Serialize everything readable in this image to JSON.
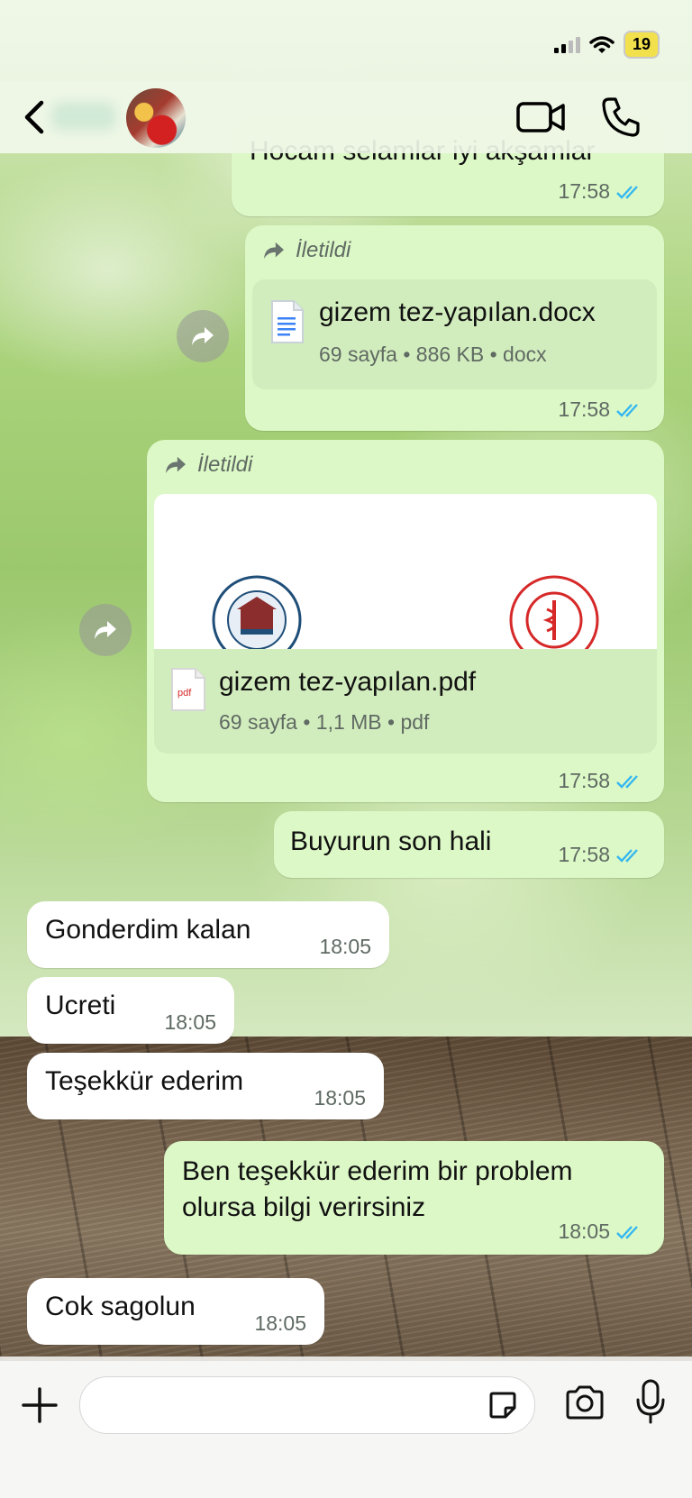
{
  "status_bar": {
    "battery": "19"
  },
  "messages": [
    {
      "id": "m1",
      "direction": "out",
      "text": "Hocam selamlar iyi akşamlar",
      "time": "17:58",
      "read": true
    },
    {
      "id": "m2",
      "direction": "out",
      "forwarded_label": "İletildi",
      "document": {
        "name": "gizem tez-yapılan.docx",
        "info": "69 sayfa • 886 KB • docx",
        "icon": "doc-icon"
      },
      "time": "17:58",
      "read": true
    },
    {
      "id": "m3",
      "direction": "out",
      "forwarded_label": "İletildi",
      "document": {
        "name": "gizem tez-yapılan.pdf",
        "info": "69 sayfa • 1,1 MB • pdf",
        "icon_label": "pdf"
      },
      "time": "17:58",
      "read": true
    },
    {
      "id": "m4",
      "direction": "out",
      "text": "Buyurun son hali",
      "time": "17:58",
      "read": true
    },
    {
      "id": "m5",
      "direction": "in",
      "text": "Gonderdim kalan",
      "time": "18:05"
    },
    {
      "id": "m6",
      "direction": "in",
      "text": "Ucreti",
      "time": "18:05"
    },
    {
      "id": "m7",
      "direction": "in",
      "text": "Teşekkür ederim",
      "time": "18:05"
    },
    {
      "id": "m8",
      "direction": "out",
      "text": "Ben teşekkür ederim bir problem\nolursa bilgi verirsiniz",
      "time": "18:05",
      "read": true
    },
    {
      "id": "m9",
      "direction": "in",
      "text": "Cok sagolun",
      "time": "18:05"
    }
  ],
  "colors": {
    "outgoing_bubble": "#dcf8c6",
    "incoming_bubble": "#ffffff",
    "read_ticks": "#34b7f1"
  },
  "input": {
    "value": "",
    "placeholder": ""
  },
  "icons": [
    "back-icon",
    "video-call-icon",
    "phone-icon",
    "forward-icon",
    "doc-icon",
    "plus-icon",
    "sticker-icon",
    "camera-icon",
    "mic-icon"
  ]
}
